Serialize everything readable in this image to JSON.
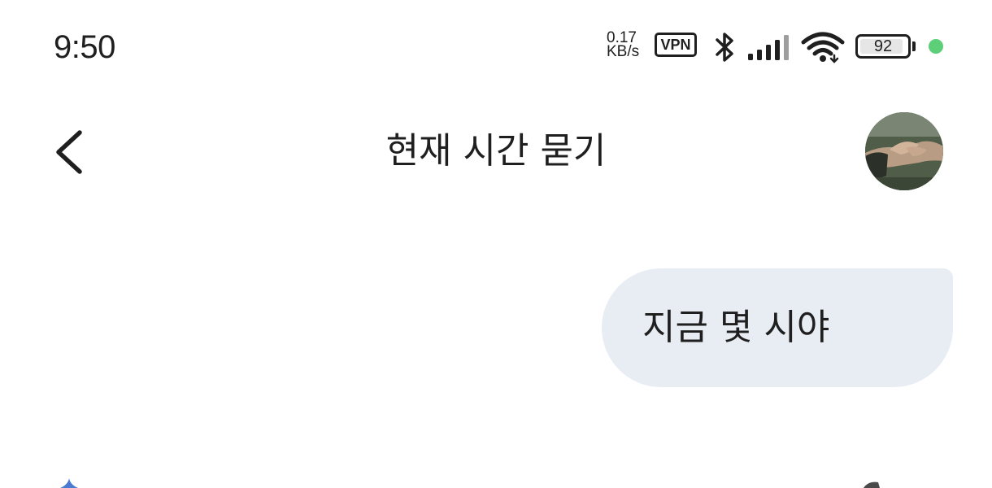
{
  "status_bar": {
    "time": "9:50",
    "net_speed_value": "0.17",
    "net_speed_unit": "KB/s",
    "vpn_label": "VPN",
    "battery_percent": "92",
    "battery_level": 0.92,
    "dot_color": "#5ccf78"
  },
  "app_bar": {
    "back_icon": "chevron-left",
    "title": "현재 시간 묻기",
    "avatar_icon": "user-avatar"
  },
  "messages": [
    {
      "sender": "user",
      "text": "지금 몇 시야"
    }
  ],
  "colors": {
    "bubble_background": "#e8edf4",
    "text": "#1f1f1f",
    "background": "#ffffff"
  }
}
